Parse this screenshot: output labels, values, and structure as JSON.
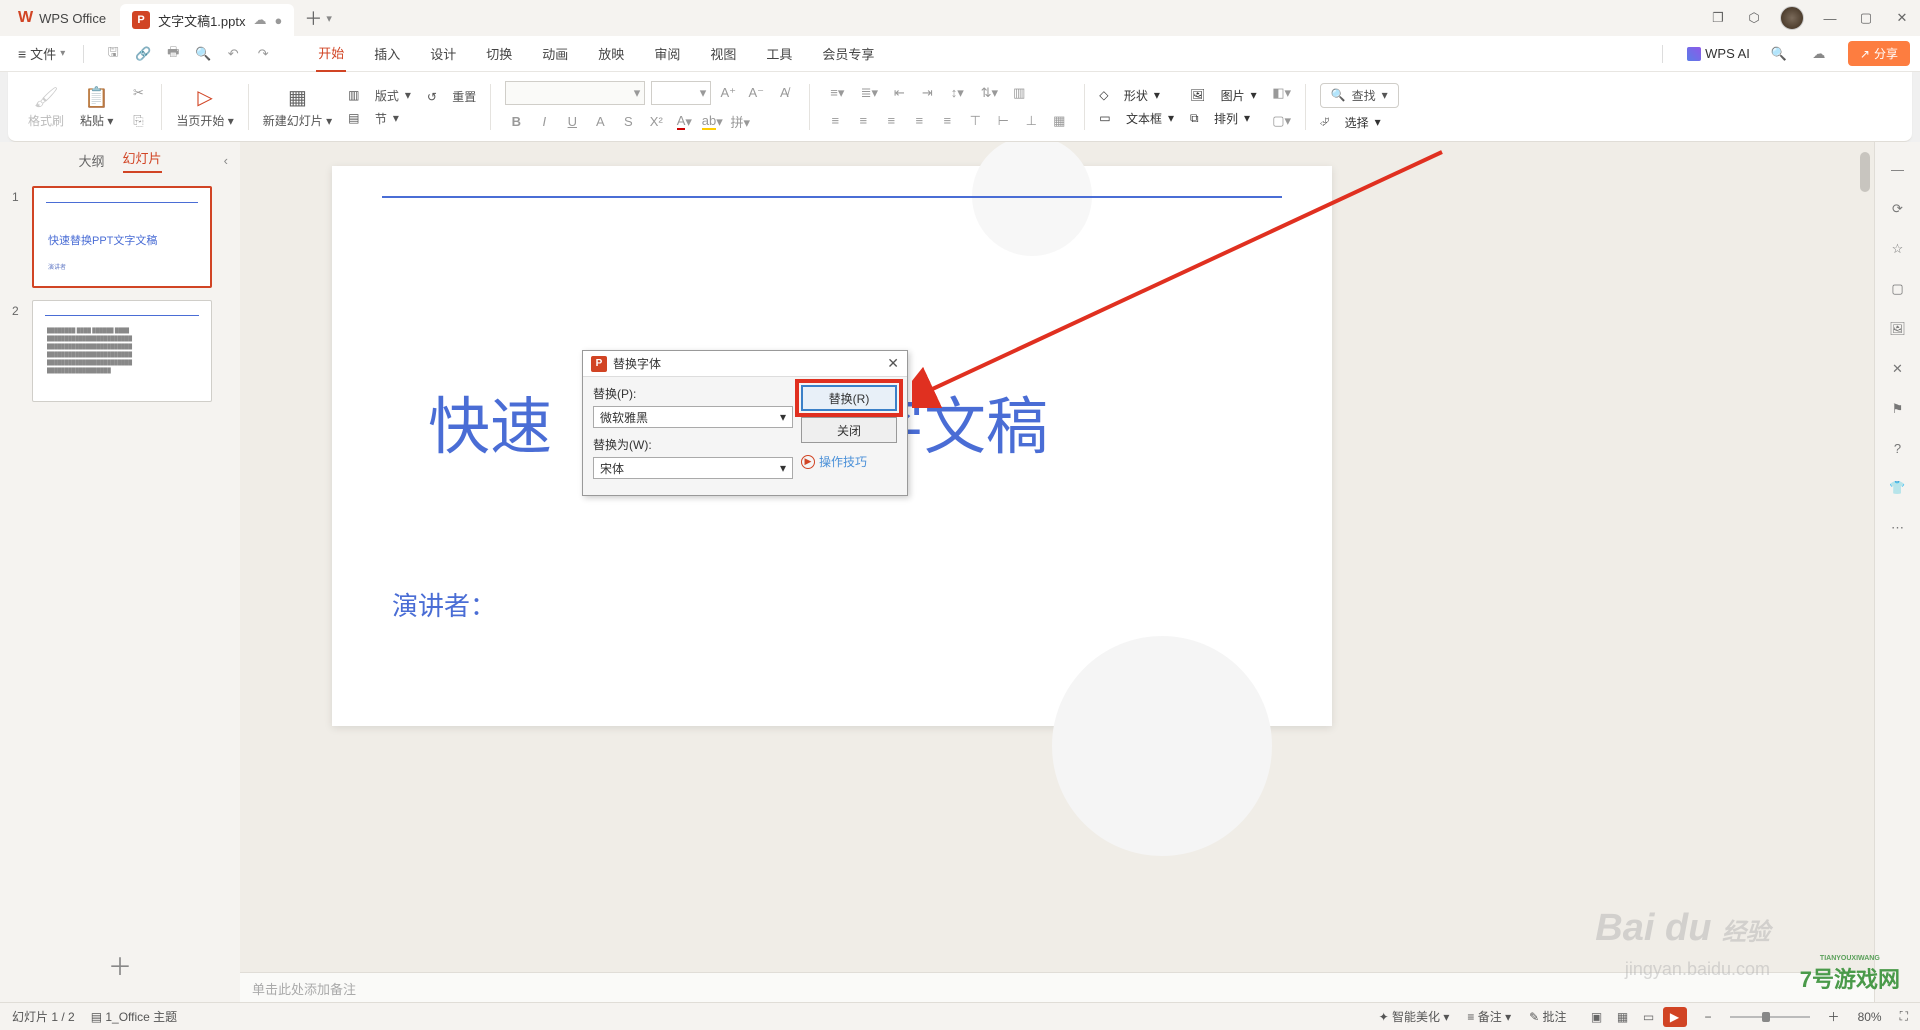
{
  "titlebar": {
    "app_name": "WPS Office",
    "doc_name": "文字文稿1.pptx",
    "add": "＋"
  },
  "menubar": {
    "file": "文件",
    "tabs": [
      "开始",
      "插入",
      "设计",
      "切换",
      "动画",
      "放映",
      "审阅",
      "视图",
      "工具",
      "会员专享"
    ],
    "active_tab": 0,
    "wps_ai": "WPS AI",
    "share": "分享"
  },
  "ribbon": {
    "format_painter": "格式刷",
    "paste": "粘贴",
    "from_current": "当页开始",
    "new_slide": "新建幻灯片",
    "layout": "版式",
    "reset": "重置",
    "section": "节",
    "shape": "形状",
    "picture": "图片",
    "textbox": "文本框",
    "arrange": "排列",
    "find": "查找",
    "select": "选择"
  },
  "sidebar": {
    "tab_outline": "大纲",
    "tab_slides": "幻灯片",
    "slides": [
      {
        "title": "快速替换PPT文字文稿",
        "sub": "演讲者"
      },
      {
        "body": "lorem"
      }
    ]
  },
  "slide": {
    "title": "快速　　　　　字文稿",
    "subtitle": "演讲者："
  },
  "dialog": {
    "title": "替换字体",
    "replace_label": "替换(P):",
    "replace_value": "微软雅黑",
    "with_label": "替换为(W):",
    "with_value": "宋体",
    "btn_replace": "替换(R)",
    "btn_close": "关闭",
    "tips": "操作技巧"
  },
  "notes": {
    "placeholder": "单击此处添加备注"
  },
  "statusbar": {
    "slide_info": "幻灯片 1 / 2",
    "theme": "1_Office 主题",
    "beautify": "智能美化",
    "notes_btn": "备注",
    "comments": "批注",
    "zoom": "80%"
  },
  "watermark": {
    "brand": "Bai",
    "brand2": "du",
    "brand3": "经验",
    "sub": "jingyan.baidu.com",
    "game_small": "TIANYOUXIWANG",
    "game": "7号游戏网"
  }
}
